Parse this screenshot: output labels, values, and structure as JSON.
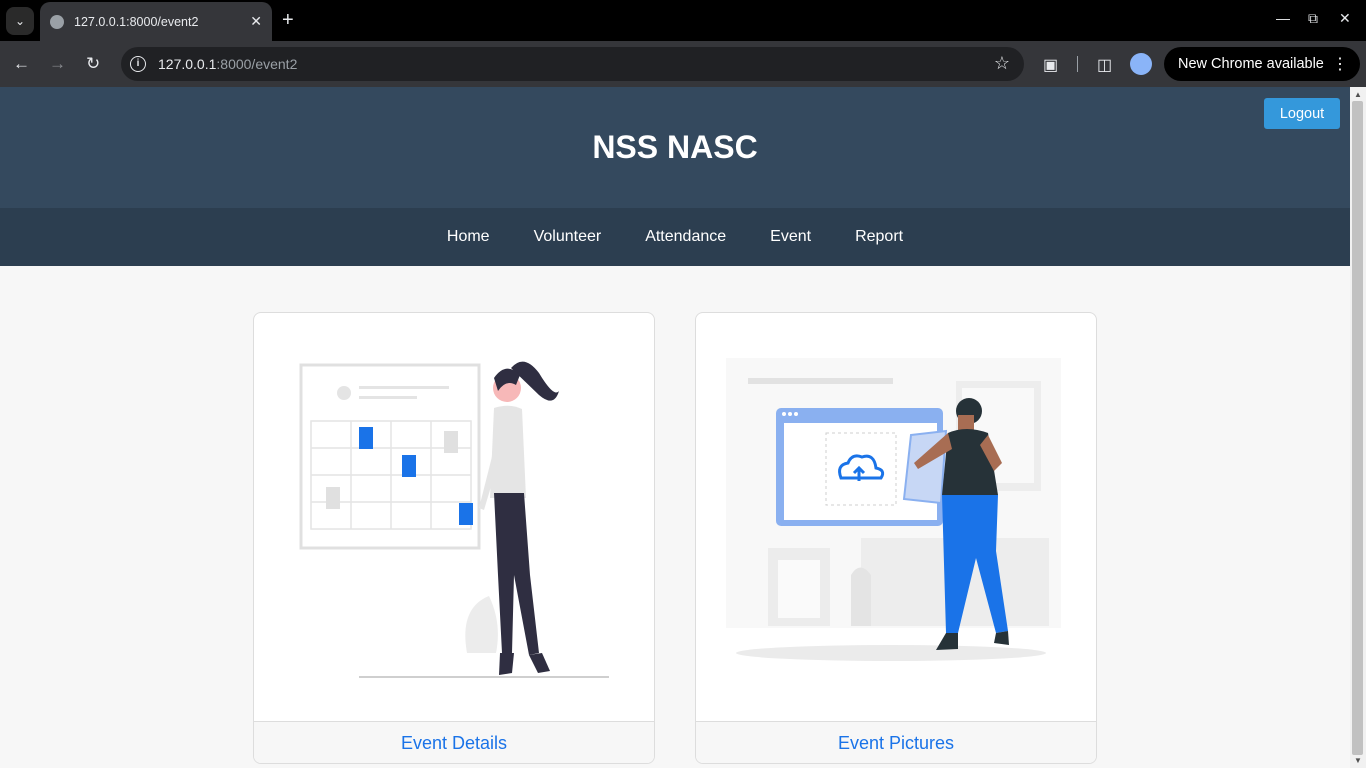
{
  "browser": {
    "tab_title": "127.0.0.1:8000/event2",
    "url_host": "127.0.0.1",
    "url_path": ":8000/event2",
    "update_label": "New Chrome available"
  },
  "header": {
    "title": "NSS NASC",
    "logout_label": "Logout"
  },
  "nav": {
    "items": [
      {
        "label": "Home"
      },
      {
        "label": "Volunteer"
      },
      {
        "label": "Attendance"
      },
      {
        "label": "Event"
      },
      {
        "label": "Report"
      }
    ]
  },
  "cards": [
    {
      "label": "Event Details",
      "illustration": "calendar-planning-illustration"
    },
    {
      "label": "Event Pictures",
      "illustration": "upload-pictures-illustration"
    }
  ],
  "colors": {
    "header_bg": "#34495e",
    "nav_bg": "#2c3e50",
    "accent": "#3498db",
    "link": "#1a73e8"
  }
}
